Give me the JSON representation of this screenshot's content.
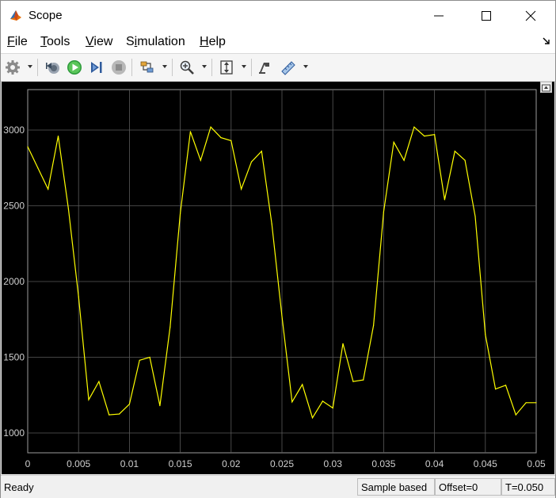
{
  "window": {
    "title": "Scope"
  },
  "menu": {
    "items": [
      {
        "pre": "",
        "ul": "F",
        "post": "ile"
      },
      {
        "pre": "",
        "ul": "T",
        "post": "ools"
      },
      {
        "pre": "",
        "ul": "V",
        "post": "iew"
      },
      {
        "pre": "S",
        "ul": "i",
        "post": "mulation"
      },
      {
        "pre": "",
        "ul": "H",
        "post": "elp"
      }
    ]
  },
  "toolbar": {
    "icons": [
      "gear-icon",
      "step-back-icon",
      "run-icon",
      "step-forward-icon",
      "stop-icon",
      "signal-select-icon",
      "zoom-icon",
      "autoscale-icon",
      "highlight-icon",
      "measure-icon"
    ]
  },
  "chart_data": {
    "type": "line",
    "background": "#000000",
    "line_color": "#ffff00",
    "grid": true,
    "xlim": [
      0,
      0.05
    ],
    "ylim": [
      1000,
      3000
    ],
    "x_tick_labels": [
      "0",
      "0.005",
      "0.01",
      "0.015",
      "0.02",
      "0.025",
      "0.03",
      "0.035",
      "0.04",
      "0.045",
      "0.05"
    ],
    "y_tick_labels": [
      "1000",
      "1500",
      "2000",
      "2500",
      "3000"
    ],
    "series": [
      {
        "x": [
          0,
          0.001,
          0.002,
          0.003,
          0.004,
          0.005,
          0.006,
          0.007,
          0.008,
          0.009,
          0.01,
          0.011,
          0.012,
          0.013,
          0.014,
          0.015,
          0.016,
          0.017,
          0.018,
          0.019,
          0.02,
          0.021,
          0.022,
          0.023,
          0.024,
          0.025,
          0.026,
          0.027,
          0.028,
          0.029,
          0.03,
          0.031,
          0.032,
          0.033,
          0.034,
          0.035,
          0.036,
          0.037,
          0.038,
          0.039,
          0.04,
          0.041,
          0.042,
          0.043,
          0.044,
          0.045,
          0.046,
          0.047,
          0.048,
          0.049,
          0.05
        ],
        "y": [
          2890,
          2750,
          2610,
          2960,
          2480,
          1900,
          1220,
          1340,
          1120,
          1125,
          1190,
          1480,
          1500,
          1180,
          1700,
          2450,
          2990,
          2800,
          3020,
          2950,
          2930,
          2610,
          2790,
          2860,
          2380,
          1770,
          1205,
          1320,
          1100,
          1210,
          1165,
          1590,
          1340,
          1350,
          1710,
          2460,
          2920,
          2800,
          3020,
          2960,
          2970,
          2540,
          2860,
          2800,
          2430,
          1650,
          1290,
          1315,
          1120,
          1200,
          1200
        ]
      }
    ]
  },
  "status": {
    "ready": "Ready",
    "sample": "Sample based",
    "offset": "Offset=0",
    "time": "T=0.050"
  }
}
